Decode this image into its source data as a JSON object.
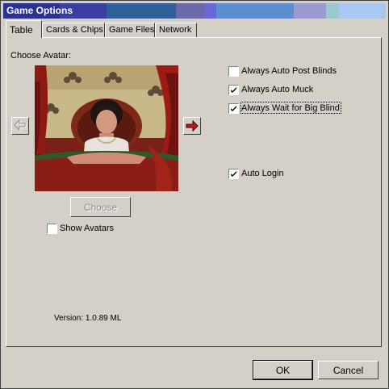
{
  "window": {
    "title": "Game Options"
  },
  "tabs": [
    {
      "label": "Table"
    },
    {
      "label": "Cards & Chips"
    },
    {
      "label": "Game Files"
    },
    {
      "label": "Network"
    }
  ],
  "avatar": {
    "heading": "Choose Avatar:",
    "choose_label": "Choose",
    "show_avatars_label": "Show Avatars",
    "show_avatars_checked": false
  },
  "options": [
    {
      "label": "Always Auto Post Blinds",
      "checked": false
    },
    {
      "label": "Always Auto Muck",
      "checked": true
    },
    {
      "label": "Always Wait for Big Blind",
      "checked": true
    },
    {
      "label": "Auto Login",
      "checked": true
    }
  ],
  "version": "Version: 1.0.89 ML",
  "buttons": {
    "ok": "OK",
    "cancel": "Cancel"
  },
  "colors": {
    "face": "#d4d0c8",
    "title_start": "#2c3a8a",
    "next_arrow": "#c01818"
  }
}
